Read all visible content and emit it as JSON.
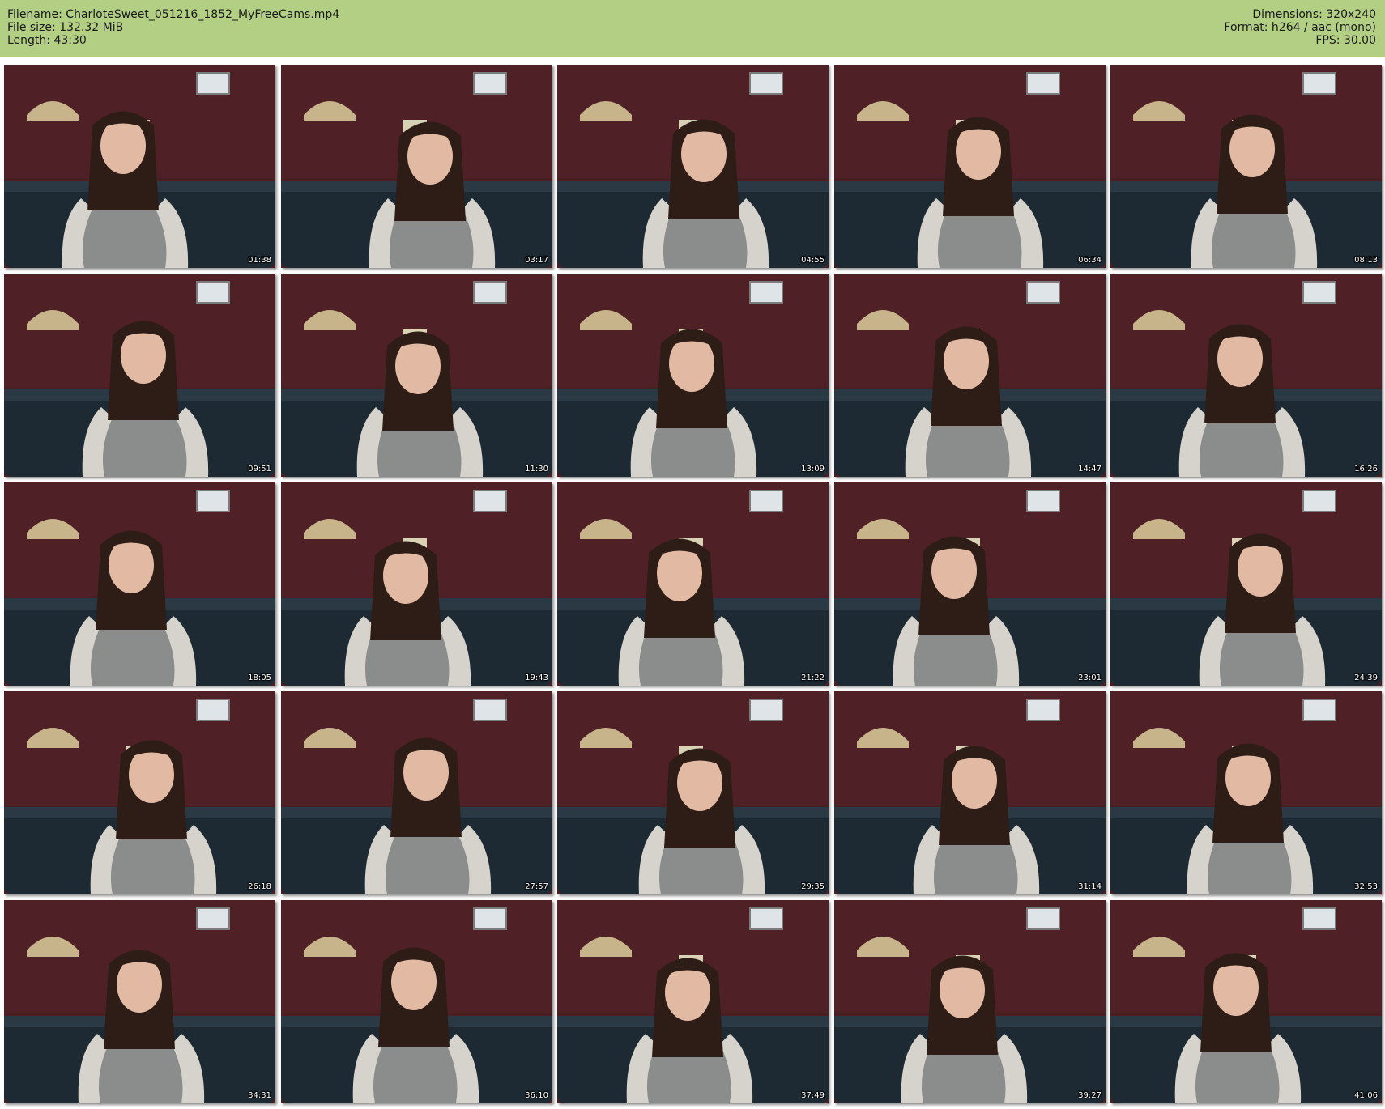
{
  "header": {
    "filename": "Filename: CharloteSweet_051216_1852_MyFreeCams.mp4",
    "filesize": "File size: 132.32 MiB",
    "length": "Length: 43:30",
    "dimensions": "Dimensions: 320x240",
    "format": "Format: h264 / aac (mono)",
    "fps": "FPS: 30.00"
  },
  "colors": {
    "header_bg": "#b3cf84",
    "wall": "#4a1f24",
    "sofa": "#1e2a33",
    "sweater": "#8a8d8c",
    "sleeve": "#d6d3cc",
    "hair": "#2e1d16",
    "skin": "#e2b9a3"
  },
  "thumbnails": [
    {
      "timestamp": "01:38"
    },
    {
      "timestamp": "03:17"
    },
    {
      "timestamp": "04:55"
    },
    {
      "timestamp": "06:34"
    },
    {
      "timestamp": "08:13"
    },
    {
      "timestamp": "09:51"
    },
    {
      "timestamp": "11:30"
    },
    {
      "timestamp": "13:09"
    },
    {
      "timestamp": "14:47"
    },
    {
      "timestamp": "16:26"
    },
    {
      "timestamp": "18:05"
    },
    {
      "timestamp": "19:43"
    },
    {
      "timestamp": "21:22"
    },
    {
      "timestamp": "23:01"
    },
    {
      "timestamp": "24:39"
    },
    {
      "timestamp": "26:18"
    },
    {
      "timestamp": "27:57"
    },
    {
      "timestamp": "29:35"
    },
    {
      "timestamp": "31:14"
    },
    {
      "timestamp": "32:53"
    },
    {
      "timestamp": "34:31"
    },
    {
      "timestamp": "36:10"
    },
    {
      "timestamp": "37:49"
    },
    {
      "timestamp": "39:27"
    },
    {
      "timestamp": "41:06"
    }
  ]
}
